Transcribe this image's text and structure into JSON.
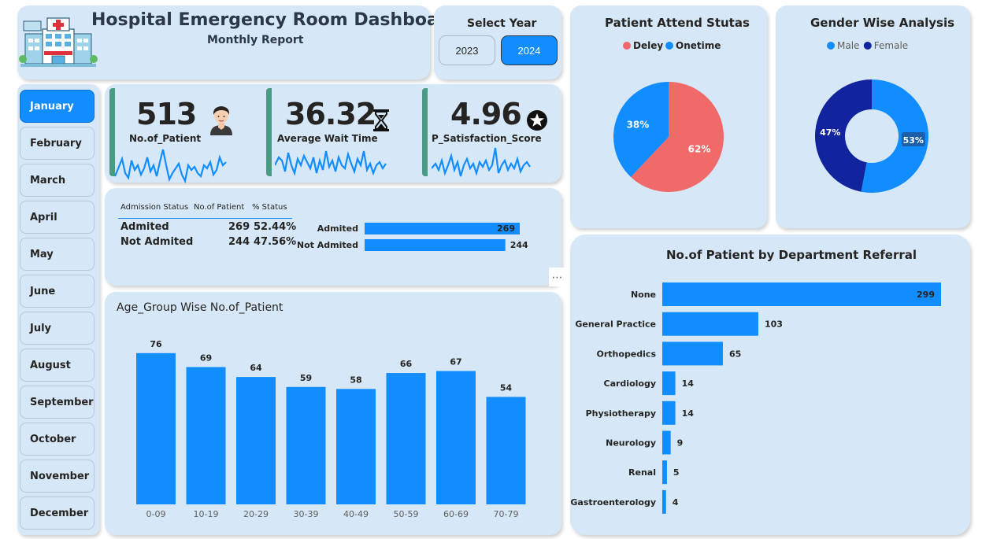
{
  "header": {
    "title": "Hospital Emergency Room Dashboard",
    "subtitle": "Monthly Report",
    "logo_icon": "hospital-building-icon"
  },
  "year_selector": {
    "label": "Select Year",
    "years": [
      "2023",
      "2024"
    ],
    "selected": "2024"
  },
  "months": [
    "January",
    "February",
    "March",
    "April",
    "May",
    "June",
    "July",
    "August",
    "September",
    "October",
    "November",
    "December"
  ],
  "selected_month": "January",
  "kpis": [
    {
      "value": "513",
      "label": "No.of_Patient",
      "icon": "patient-avatar-icon"
    },
    {
      "value": "36.32",
      "label": "Average Wait Time",
      "icon": "hourglass-icon"
    },
    {
      "value": "4.96",
      "label": "P_Satisfaction_Score",
      "icon": "star-circle-icon"
    }
  ],
  "colors": {
    "accent": "#118dff",
    "card": "#d6e8f7",
    "delay": "#f06a6a",
    "female": "#12239e",
    "kpi_bar": "#4a9a84"
  },
  "admission": {
    "headers": [
      "Admission Status",
      "No.of Patient",
      "% Status"
    ],
    "rows": [
      {
        "status": "Admited",
        "count": "269",
        "pct": "52.44%"
      },
      {
        "status": "Not Admited",
        "count": "244",
        "pct": "47.56%"
      }
    ],
    "more_icon": "ellipsis-icon"
  },
  "charts": {
    "attend": {
      "title": "Patient Attend Stutas"
    },
    "gender": {
      "title": "Gender Wise Analysis"
    },
    "age": {
      "title": "Age_Group Wise No.of_Patient"
    },
    "dept": {
      "title": "No.of Patient by Department Referral"
    }
  },
  "chart_data": [
    {
      "type": "bar",
      "orientation": "horizontal",
      "categories": [
        "Admited",
        "Not Admited"
      ],
      "values": [
        269,
        244
      ]
    },
    {
      "type": "pie",
      "title": "Patient Attend Stutas",
      "legend": "top",
      "slices": [
        {
          "name": "Deley",
          "value": 62,
          "label": "62%",
          "color": "#f06a6a"
        },
        {
          "name": "Onetime",
          "value": 38,
          "label": "38%",
          "color": "#118dff"
        }
      ]
    },
    {
      "type": "pie",
      "subtype": "donut",
      "title": "Gender Wise Analysis",
      "legend": "top",
      "slices": [
        {
          "name": "Male",
          "value": 53,
          "label": "53%",
          "color": "#118dff"
        },
        {
          "name": "Female",
          "value": 47,
          "label": "47%",
          "color": "#12239e"
        }
      ]
    },
    {
      "type": "bar",
      "title": "Age_Group Wise No.of_Patient",
      "categories": [
        "0-09",
        "10-19",
        "20-29",
        "30-39",
        "40-49",
        "50-59",
        "60-69",
        "70-79"
      ],
      "values": [
        76,
        69,
        64,
        59,
        58,
        66,
        67,
        54
      ],
      "ylim": [
        0,
        85
      ]
    },
    {
      "type": "bar",
      "orientation": "horizontal",
      "title": "No.of Patient by Department Referral",
      "categories": [
        "None",
        "General Practice",
        "Orthopedics",
        "Cardiology",
        "Physiotherapy",
        "Neurology",
        "Renal",
        "Gastroenterology"
      ],
      "values": [
        299,
        103,
        65,
        14,
        14,
        9,
        5,
        4
      ]
    }
  ]
}
